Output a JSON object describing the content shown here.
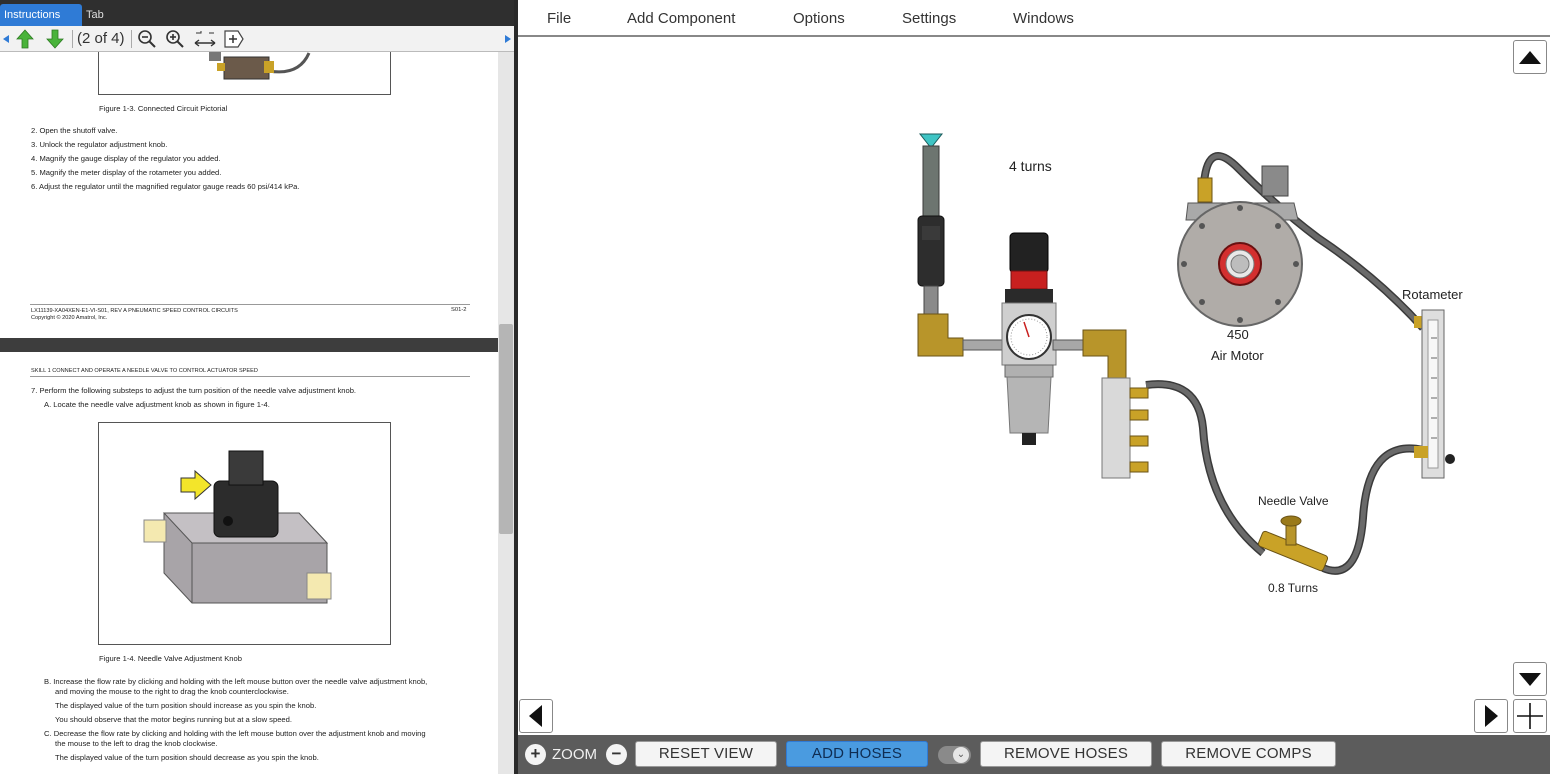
{
  "left_panel": {
    "tabs": [
      {
        "label": "Instructions"
      },
      {
        "label": "Tab"
      }
    ],
    "toolbar": {
      "page_indicator": "(2 of 4)"
    },
    "page1": {
      "figure_caption": "Figure 1-3.   Connected Circuit Pictorial",
      "steps": [
        "2.   Open the shutoff valve.",
        "3.   Unlock the regulator adjustment knob.",
        "4.   Magnify the gauge display of the regulator you added.",
        "5.   Magnify the meter display of the rotameter you added.",
        "6.   Adjust the regulator until the magnified regulator gauge reads 60 psi/414 kPa."
      ],
      "footer_left": "LX11139-XA04XEN-E1-VI-S01, REV A   PNEUMATIC SPEED CONTROL CIRCUITS",
      "footer_right": "S01-2",
      "copyright": "Copyright © 2020 Amatrol, Inc."
    },
    "page2": {
      "header": "SKILL 1   CONNECT AND OPERATE A NEEDLE VALVE TO CONTROL ACTUATOR SPEED",
      "step7": "7.   Perform the following substeps to adjust the turn position of the needle valve adjustment knob.",
      "step7a": "A.   Locate the needle valve adjustment knob as shown in figure 1-4.",
      "figure_caption": "Figure 1-4.   Needle Valve Adjustment Knob",
      "step7b_1": "B.   Increase the flow rate by clicking and holding with the left mouse button over the needle valve adjustment knob,",
      "step7b_2": "and moving the mouse to the right to drag the knob counterclockwise.",
      "step7b_3": "The displayed value of the turn position should increase as you spin the knob.",
      "step7b_4": "You should observe that the motor begins running but at a slow speed.",
      "step7c_1": "C.   Decrease the flow rate by clicking and holding with the left mouse button over the adjustment knob and moving",
      "step7c_2": "the mouse to the left to drag the knob clockwise.",
      "step7c_3": "The displayed value of the turn position should decrease as you spin the knob."
    }
  },
  "menu": [
    "File",
    "Add Component",
    "Options",
    "Settings",
    "Windows"
  ],
  "canvas": {
    "regulator_turns": "4 turns",
    "air_motor_value": "450",
    "air_motor_label": "Air Motor",
    "rotameter_label": "Rotameter",
    "needle_valve_label": "Needle Valve",
    "needle_valve_turns": "0.8 Turns"
  },
  "bottom_bar": {
    "zoom_label": "ZOOM",
    "reset_view": "RESET VIEW",
    "add_hoses": "ADD HOSES",
    "remove_hoses": "REMOVE HOSES",
    "remove_comps": "REMOVE COMPS"
  },
  "colors": {
    "accent_blue": "#2f7bd6",
    "add_hoses_bg": "#4a9be0",
    "brass": "#c9a227",
    "hose": "#5a5a5a"
  }
}
